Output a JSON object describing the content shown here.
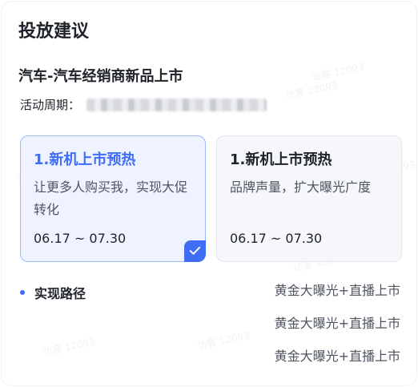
{
  "panel": {
    "title": "投放建议",
    "campaign_title": "汽车-汽车经销商新品上市",
    "period_label": "活动周期："
  },
  "cards": [
    {
      "title": "1.新机上市预热",
      "desc": "让更多人购买我，实现大促转化",
      "date": "06.17 ~ 07.30",
      "selected": true
    },
    {
      "title": "1.新机上市预热",
      "desc": "品牌声量，扩大曝光广度",
      "date": "06.17 ~ 07.30",
      "selected": false
    }
  ],
  "path": {
    "label": "实现路径",
    "items": [
      "黄金大曝光+直播上市",
      "黄金大曝光+直播上市",
      "黄金大曝光+直播上市"
    ]
  },
  "watermark": "访客 12093",
  "colors": {
    "accent": "#3f6df5",
    "selected_bg": "#eef3ff",
    "text": "#1f2329"
  },
  "icons": {
    "selected_check": "check-icon"
  }
}
